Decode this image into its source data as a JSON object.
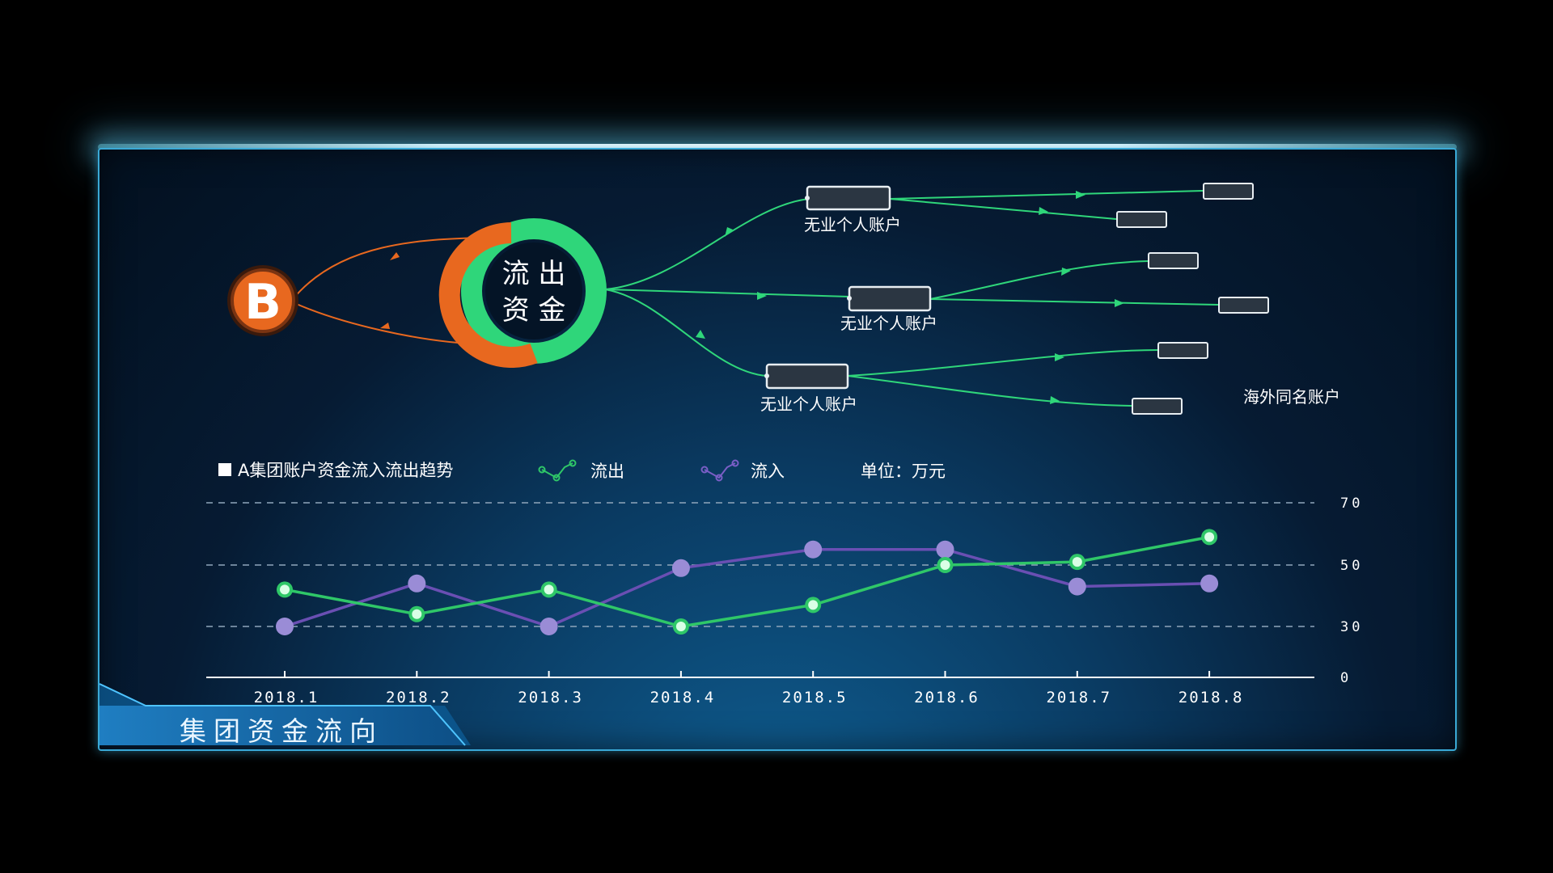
{
  "panel": {
    "title": "集团资金流向"
  },
  "flow": {
    "source_label": "B",
    "hub_line1": "流 出",
    "hub_line2": "资 金",
    "account_labels": [
      "无业个人账户",
      "无业个人账户",
      "无业个人账户"
    ],
    "overseas_label": "海外同名账户",
    "colors": {
      "outflow": "#2fd67a",
      "source": "#e8681f",
      "box_border": "#e8eef2"
    }
  },
  "chart_data": {
    "type": "line",
    "title": "A集团账户资金流入流出趋势",
    "unit": "单位：万元",
    "categories": [
      "2018.1",
      "2018.2",
      "2018.3",
      "2018.4",
      "2018.5",
      "2018.6",
      "2018.7",
      "2018.8"
    ],
    "series": [
      {
        "name": "流出",
        "color": "#2fc768",
        "values": [
          42,
          34,
          42,
          30,
          37,
          50,
          51,
          59
        ]
      },
      {
        "name": "流入",
        "color": "#6a4fb3",
        "values": [
          30,
          44,
          30,
          49,
          55,
          55,
          43,
          44
        ]
      }
    ],
    "ytick_labels": [
      "0",
      "30",
      "50",
      "70"
    ],
    "ylim": [
      0,
      70
    ],
    "grid": true,
    "legend_position": "top-left"
  }
}
